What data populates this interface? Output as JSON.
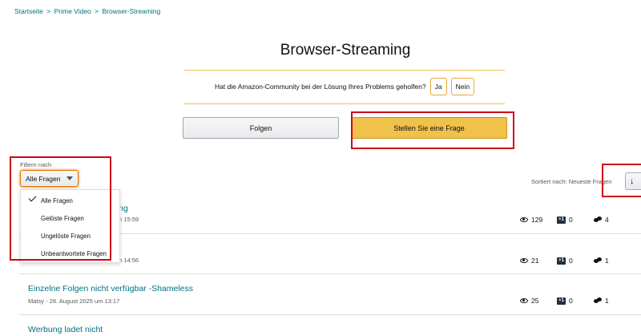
{
  "breadcrumb": {
    "items": [
      "Startseite",
      "Prime Video",
      "Browser-Streaming"
    ],
    "separator": ">"
  },
  "page": {
    "title": "Browser-Streaming"
  },
  "feedback": {
    "question": "Hat die Amazon-Community bei der Lösung Ihres Problems geholfen?",
    "yes_label": "Ja",
    "no_label": "Nein"
  },
  "actions": {
    "follow_label": "Folgen",
    "ask_label": "Stellen Sie eine Frage"
  },
  "filter": {
    "label": "Filtern nach",
    "selected": "Alle Fragen",
    "options": [
      "Alle Fragen",
      "Gelöste Fragen",
      "Ungelöste Fragen",
      "Unbeantwortete Fragen"
    ]
  },
  "sort": {
    "label": "Sortiert nach: Neueste Fragen",
    "icon": "↓"
  },
  "questions": [
    {
      "title": "ng",
      "meta": "m 15:59",
      "views": "129",
      "votes": "0",
      "replies": "4"
    },
    {
      "title": "",
      "meta": "m 14:56",
      "views": "21",
      "votes": "0",
      "replies": "1"
    },
    {
      "title": "Einzelne Folgen nicht verfügbar -Shameless",
      "meta": "Matsy - 28. August 2025 um 13:17",
      "views": "25",
      "votes": "0",
      "replies": "1"
    },
    {
      "title": "Werbung ladet nicht",
      "meta": "",
      "views": "",
      "votes": "",
      "replies": ""
    }
  ],
  "icons": {
    "views": "eye-icon",
    "votes": "plus-one-icon",
    "replies": "reply-bubbles-icon",
    "check": "check-icon"
  },
  "colors": {
    "link": "#007185",
    "accent_yellow": "#f0c14b",
    "highlight_red": "#d0021b"
  }
}
